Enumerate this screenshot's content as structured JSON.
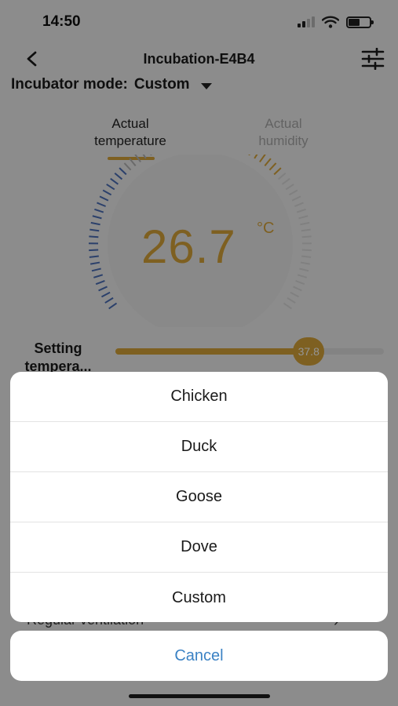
{
  "status_bar": {
    "time": "14:50"
  },
  "nav": {
    "title": "Incubation-E4B4"
  },
  "mode": {
    "label": "Incubator mode",
    "separator": ":",
    "value": "Custom"
  },
  "tabs": [
    {
      "label_line1": "Actual",
      "label_line2": "temperature"
    },
    {
      "label_line1": "Actual",
      "label_line2": "humidity"
    }
  ],
  "gauge": {
    "value": "26.7",
    "unit": "°C"
  },
  "setting": {
    "label_line1": "Setting",
    "label_line2": "tempera...",
    "value": "37.8",
    "level_fraction": 0.72
  },
  "background_row": {
    "label": "Regular ventilation"
  },
  "action_sheet": {
    "options": [
      "Chicken",
      "Duck",
      "Goose",
      "Dove",
      "Custom"
    ],
    "cancel_label": "Cancel"
  },
  "colors": {
    "accent": "#d9a53a",
    "cancel_text": "#3b82c4",
    "cold_tick": "#4a6fb8"
  }
}
